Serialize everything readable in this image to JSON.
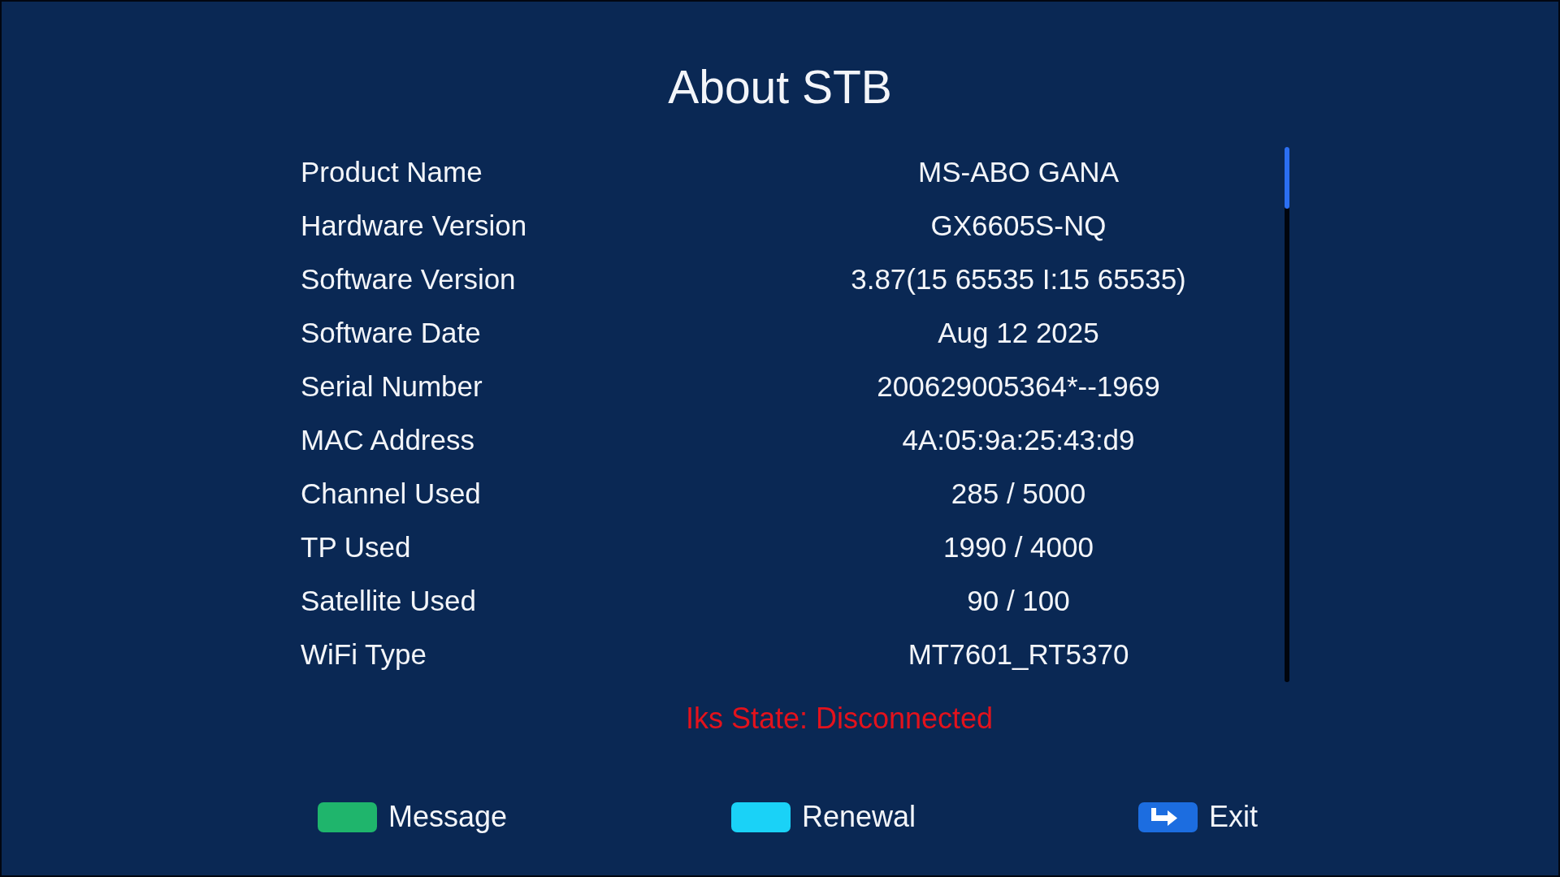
{
  "screen": {
    "title": "About STB"
  },
  "info": [
    {
      "label": "Product Name",
      "value": "MS-ABO GANA"
    },
    {
      "label": "Hardware Version",
      "value": "GX6605S-NQ"
    },
    {
      "label": "Software Version",
      "value": "3.87(15 65535 I:15 65535)"
    },
    {
      "label": "Software Date",
      "value": "Aug 12 2025"
    },
    {
      "label": "Serial Number",
      "value": "200629005364*--1969"
    },
    {
      "label": "MAC Address",
      "value": "4A:05:9a:25:43:d9"
    },
    {
      "label": "Channel Used",
      "value": "285 / 5000"
    },
    {
      "label": "TP Used",
      "value": "1990 / 4000"
    },
    {
      "label": "Satellite Used",
      "value": "90 / 100"
    },
    {
      "label": "WiFi Type",
      "value": "MT7601_RT5370"
    }
  ],
  "status": "Iks State: Disconnected",
  "footer": [
    {
      "kind": "color",
      "label": "Message",
      "color": "#1fb56c"
    },
    {
      "kind": "color",
      "label": "Renewal",
      "color": "#1ad2f7"
    },
    {
      "kind": "exit",
      "label": "Exit",
      "color": "#1c6de0"
    }
  ]
}
